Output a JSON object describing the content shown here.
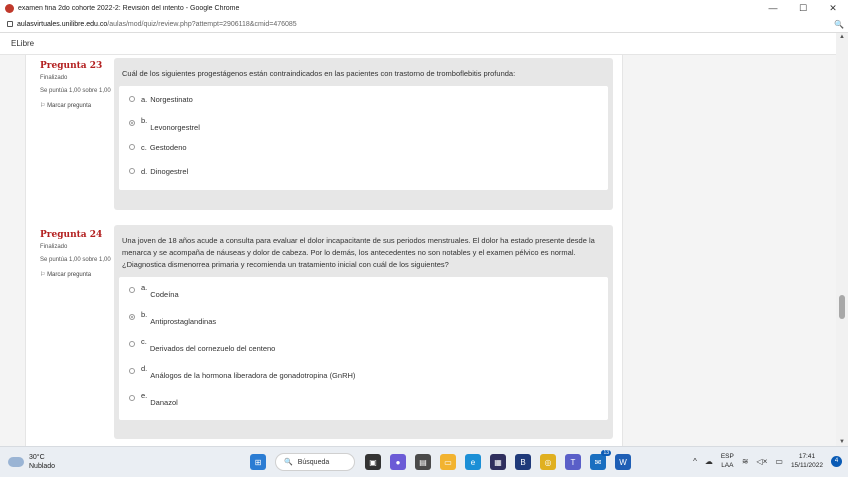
{
  "window": {
    "title": "examen fina 2do cohorte 2022-2: Revisión del intento - Google Chrome",
    "url_host": "aulasvirtuales.unilibre.edu.co",
    "url_path": "/aulas/mod/quiz/review.php?attempt=2906118&cmid=476085",
    "controls": {
      "minimize": "—",
      "maximize": "☐",
      "close": "✕"
    }
  },
  "site": {
    "name": "ELibre"
  },
  "questions": [
    {
      "number": "Pregunta 23",
      "status": "Finalizado",
      "grade": "Se puntúa 1,00 sobre 1,00",
      "flag_label": "Marcar pregunta",
      "text": "Cuál de los siguientes progestágenos están contraindicados en las pacientes con trastorno de tromboflebitis profunda:",
      "options": [
        {
          "letter": "a.",
          "text": "Norgestinato",
          "selected": false
        },
        {
          "letter": "b.",
          "text": "Levonorgestrel",
          "selected": true
        },
        {
          "letter": "c.",
          "text": "Gestodeno",
          "selected": false
        },
        {
          "letter": "d.",
          "text": "Dinogestrel",
          "selected": false
        }
      ]
    },
    {
      "number": "Pregunta 24",
      "status": "Finalizado",
      "grade": "Se puntúa 1,00 sobre 1,00",
      "flag_label": "Marcar pregunta",
      "text": "Una joven de 18 años acude a consulta para evaluar el dolor incapacitante de sus periodos menstruales. El dolor ha estado presente desde la menarca y se acompaña de náuseas y dolor de cabeza. Por lo demás, los antecedentes no son notables y el examen pélvico es normal. ¿Diagnostica dismenorrea primaria y recomienda un tratamiento inicial con cuál de los siguientes?",
      "options": [
        {
          "letter": "a.",
          "text": "Codeína",
          "selected": false
        },
        {
          "letter": "b.",
          "text": "Antiprostaglandinas",
          "selected": true
        },
        {
          "letter": "c.",
          "text": "Derivados del cornezuelo del centeno",
          "selected": false
        },
        {
          "letter": "d.",
          "text": "Análogos de la hormona liberadora de gonadotropina (GnRH)",
          "selected": false
        },
        {
          "letter": "e.",
          "text": "Danazol",
          "selected": false
        }
      ]
    }
  ],
  "taskbar": {
    "weather_temp": "30°C",
    "weather_desc": "Nublado",
    "search_label": "Búsqueda",
    "lang_top": "ESP",
    "lang_bottom": "LAA",
    "time": "17:41",
    "date": "15/11/2022",
    "notif_count": "4",
    "mail_badge": "13"
  }
}
